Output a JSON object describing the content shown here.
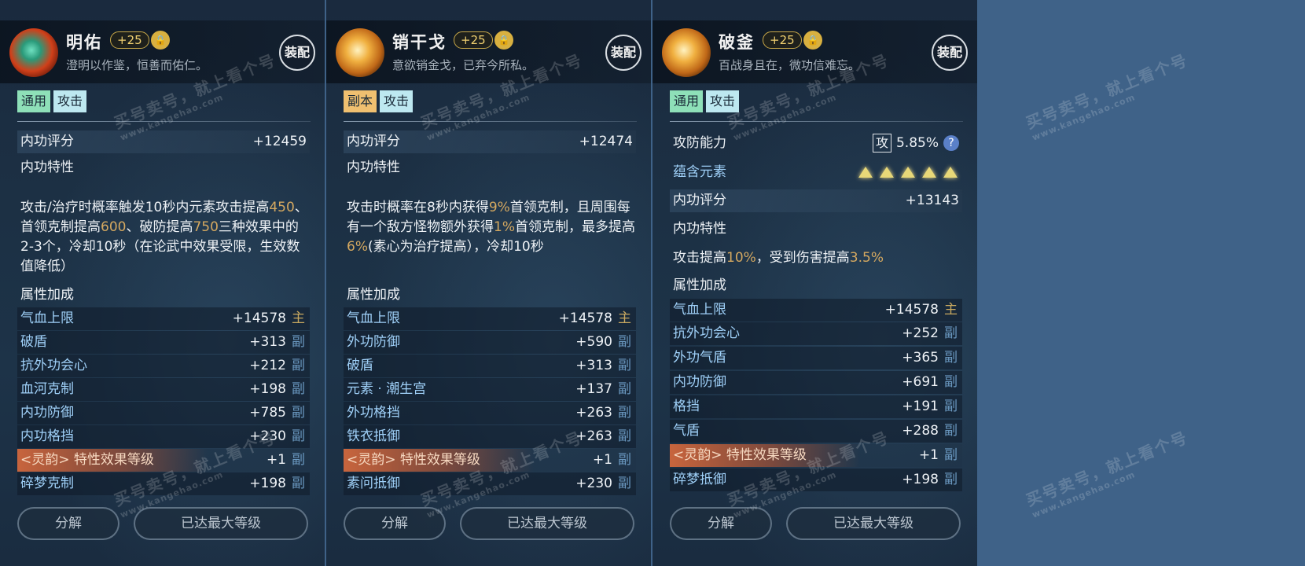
{
  "panels": [
    {
      "name": "明佑",
      "level": "+25",
      "desc": "澄明以作鉴，恒善而佑仁。",
      "equip_label": "装配",
      "tags": [
        "通用",
        "攻击"
      ],
      "score_label": "内功评分",
      "score_value": "+12459",
      "trait_label": "内功特性",
      "effect_parts": [
        "攻击/治疗时概率触发10秒内元素攻击提高",
        "450",
        "、首领克制提高",
        "600",
        "、破防提高",
        "750",
        "三种效果中的2-3个，冷却10秒（在论武中效果受限，生效数值降低）"
      ],
      "attr_label": "属性加成",
      "attrs": [
        {
          "label": "气血上限",
          "value": "+14578",
          "slot": "主"
        },
        {
          "label": "破盾",
          "value": "+313",
          "slot": "副"
        },
        {
          "label": "抗外功会心",
          "value": "+212",
          "slot": "副"
        },
        {
          "label": "血河克制",
          "value": "+198",
          "slot": "副"
        },
        {
          "label": "内功防御",
          "value": "+785",
          "slot": "副"
        },
        {
          "label": "内功格挡",
          "value": "+230",
          "slot": "副"
        },
        {
          "label": "<灵韵> 特性效果等级",
          "value": "+1",
          "slot": "副"
        },
        {
          "label": "碎梦克制",
          "value": "+198",
          "slot": "副"
        }
      ],
      "decompose_label": "分解",
      "maxed_label": "已达最大等级"
    },
    {
      "name": "销干戈",
      "level": "+25",
      "desc": "意欲销金戈，已弃今所私。",
      "equip_label": "装配",
      "tags": [
        "副本",
        "攻击"
      ],
      "score_label": "内功评分",
      "score_value": "+12474",
      "trait_label": "内功特性",
      "effect_parts": [
        "攻击时概率在8秒内获得",
        "9%",
        "首领克制，且周围每有一个敌方怪物额外获得",
        "1%",
        "首领克制，最多提高",
        "6%",
        "(素心为治疗提高），冷却10秒"
      ],
      "attr_label": "属性加成",
      "attrs": [
        {
          "label": "气血上限",
          "value": "+14578",
          "slot": "主"
        },
        {
          "label": "外功防御",
          "value": "+590",
          "slot": "副"
        },
        {
          "label": "破盾",
          "value": "+313",
          "slot": "副"
        },
        {
          "label": "元素 · 潮生宫",
          "value": "+137",
          "slot": "副"
        },
        {
          "label": "外功格挡",
          "value": "+263",
          "slot": "副"
        },
        {
          "label": "铁衣抵御",
          "value": "+263",
          "slot": "副"
        },
        {
          "label": "<灵韵> 特性效果等级",
          "value": "+1",
          "slot": "副"
        },
        {
          "label": "素问抵御",
          "value": "+230",
          "slot": "副"
        }
      ],
      "decompose_label": "分解",
      "maxed_label": "已达最大等级"
    },
    {
      "name": "破釜",
      "level": "+25",
      "desc": "百战身且在，微功信难忘。",
      "equip_label": "装配",
      "tags": [
        "通用",
        "攻击"
      ],
      "attack_defense_label": "攻防能力",
      "attack_box": "攻",
      "attack_defense_value": "5.85%",
      "help_symbol": "?",
      "element_label": "蕴含元素",
      "element_count": 5,
      "score_label": "内功评分",
      "score_value": "+13143",
      "trait_label": "内功特性",
      "effect_parts": [
        "攻击提高",
        "10%",
        "，受到伤害提高",
        "3.5%"
      ],
      "attr_label": "属性加成",
      "attrs": [
        {
          "label": "气血上限",
          "value": "+14578",
          "slot": "主"
        },
        {
          "label": "抗外功会心",
          "value": "+252",
          "slot": "副"
        },
        {
          "label": "外功气盾",
          "value": "+365",
          "slot": "副"
        },
        {
          "label": "内功防御",
          "value": "+691",
          "slot": "副"
        },
        {
          "label": "格挡",
          "value": "+191",
          "slot": "副"
        },
        {
          "label": "气盾",
          "value": "+288",
          "slot": "副"
        },
        {
          "label": "<灵韵> 特性效果等级",
          "value": "+1",
          "slot": "副"
        },
        {
          "label": "碎梦抵御",
          "value": "+198",
          "slot": "副"
        }
      ],
      "decompose_label": "分解",
      "maxed_label": "已达最大等级"
    }
  ],
  "watermark": {
    "text": "买号卖号，就上看个号",
    "url": "www.kangehao.com"
  }
}
